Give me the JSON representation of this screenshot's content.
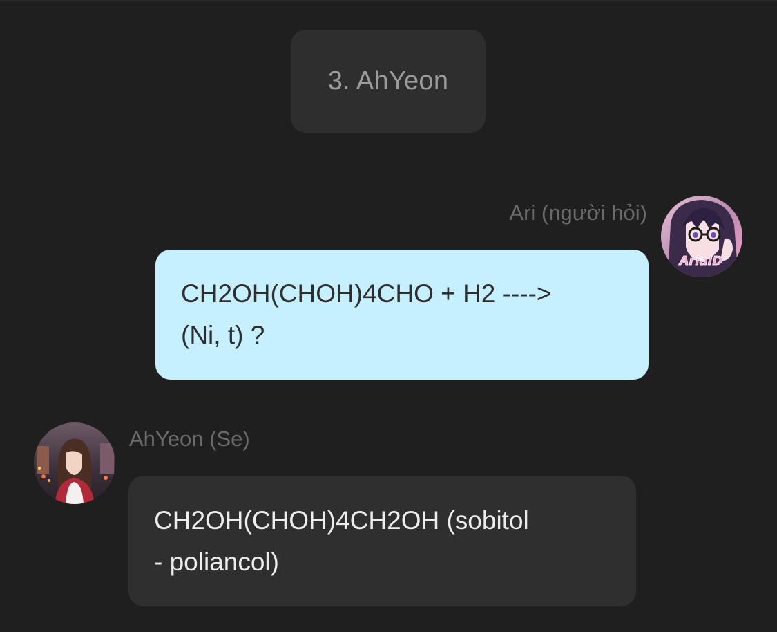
{
  "header": {
    "title": "3. AhYeon"
  },
  "messages": [
    {
      "sender": "Ari (người hỏi)",
      "avatar_icon": "anime-girl-glasses-avatar",
      "avatar_caption": "AriaID",
      "lines": [
        "CH2OH(CHOH)4CHO + H2 ---->",
        "(Ni, t) ?"
      ],
      "bubble_color": "#c6efff"
    },
    {
      "sender": "AhYeon (Se)",
      "avatar_icon": "anime-girl-city-night-avatar",
      "lines": [
        "CH2OH(CHOH)4CH2OH (sobitol",
        "- poliancol)"
      ],
      "bubble_color": "#2f2f2f"
    }
  ],
  "colors": {
    "background": "#1f1f1f",
    "chip": "#2e2e2e",
    "name_text": "#6b6b6b"
  }
}
